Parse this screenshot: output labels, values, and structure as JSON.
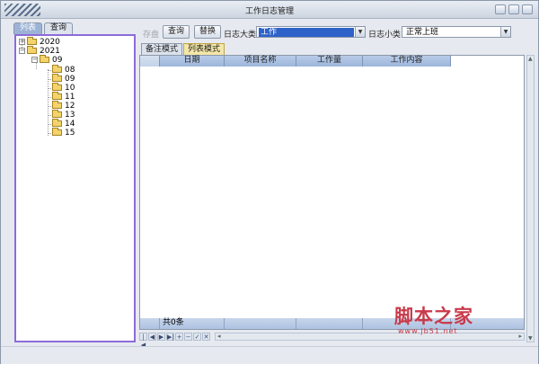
{
  "window": {
    "title": "工作日志管理"
  },
  "left_tabs": [
    {
      "label": "列表",
      "active": true
    },
    {
      "label": "查询",
      "active": false
    }
  ],
  "tree": {
    "years": [
      {
        "label": "2020",
        "expander": "+"
      },
      {
        "label": "2021",
        "expander": "−"
      }
    ],
    "month": {
      "label": "09",
      "expander": "−"
    },
    "days": [
      "08",
      "09",
      "10",
      "11",
      "12",
      "13",
      "14",
      "15"
    ]
  },
  "toolbar": {
    "save_label": "存盘",
    "query_label": "查询",
    "replace_label": "替换",
    "category_label": "日志大类",
    "category_value": "工作",
    "subcategory_label": "日志小类",
    "subcategory_value": "正常上班"
  },
  "view_tabs": [
    {
      "label": "备注模式",
      "active": false
    },
    {
      "label": "列表模式",
      "active": true
    }
  ],
  "grid": {
    "columns": [
      "日期",
      "项目名称",
      "工作量",
      "工作内容"
    ],
    "footer_count": "共0条"
  },
  "watermark": {
    "text": "脚本之家",
    "url": "www.jb51.net"
  },
  "colors": {
    "accent": "#8d6bd8",
    "header": "#9db6dc",
    "selection": "#2e62c8"
  }
}
